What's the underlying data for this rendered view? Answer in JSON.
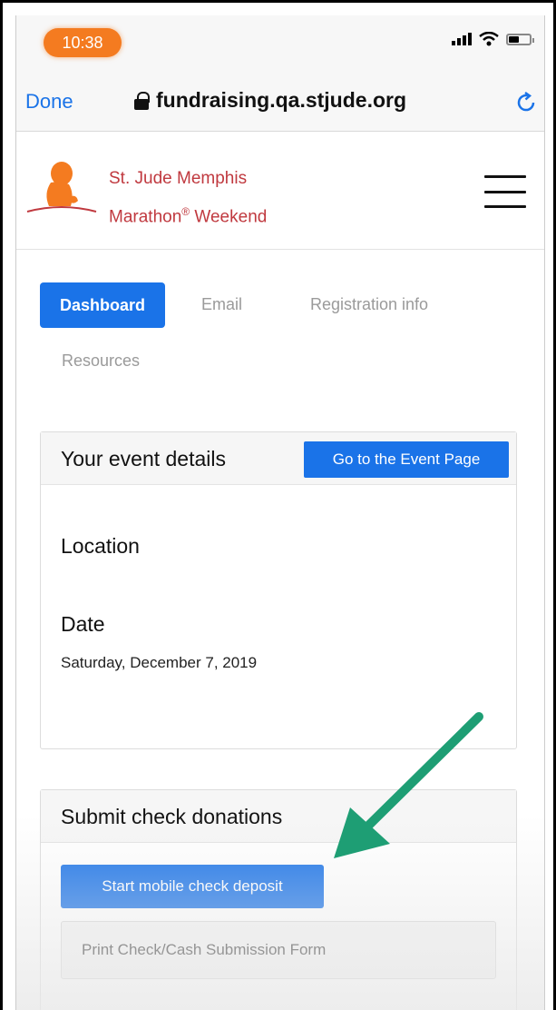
{
  "status_bar": {
    "time": "10:38",
    "icons": [
      "signal-icon",
      "wifi-icon",
      "battery-icon"
    ]
  },
  "browser": {
    "done_label": "Done",
    "url": "fundraising.qa.stjude.org",
    "icons": [
      "lock-icon",
      "reload-icon"
    ]
  },
  "header": {
    "brand_line1": "St. Jude Memphis",
    "brand_line2": "Marathon",
    "brand_mark": "®",
    "brand_line2_end": " Weekend",
    "brand_color": "#c0393f",
    "icons": [
      "st-jude-logo",
      "hamburger-menu-icon"
    ]
  },
  "tabs": {
    "items": [
      {
        "label": "Dashboard",
        "active": true
      },
      {
        "label": "Email",
        "active": false
      },
      {
        "label": "Registration info",
        "active": false
      },
      {
        "label": "Resources",
        "active": false
      }
    ]
  },
  "event_card": {
    "title": "Your event details",
    "button_label": "Go to the Event Page",
    "location_label": "Location",
    "date_label": "Date",
    "date_value": "Saturday, December 7, 2019"
  },
  "check_card": {
    "title": "Submit check donations",
    "deposit_button": "Start mobile check deposit",
    "print_button": "Print Check/Cash Submission Form"
  },
  "colors": {
    "accent": "#1a73e8",
    "time_pill": "#f47b20",
    "arrow": "#1e9e74"
  }
}
